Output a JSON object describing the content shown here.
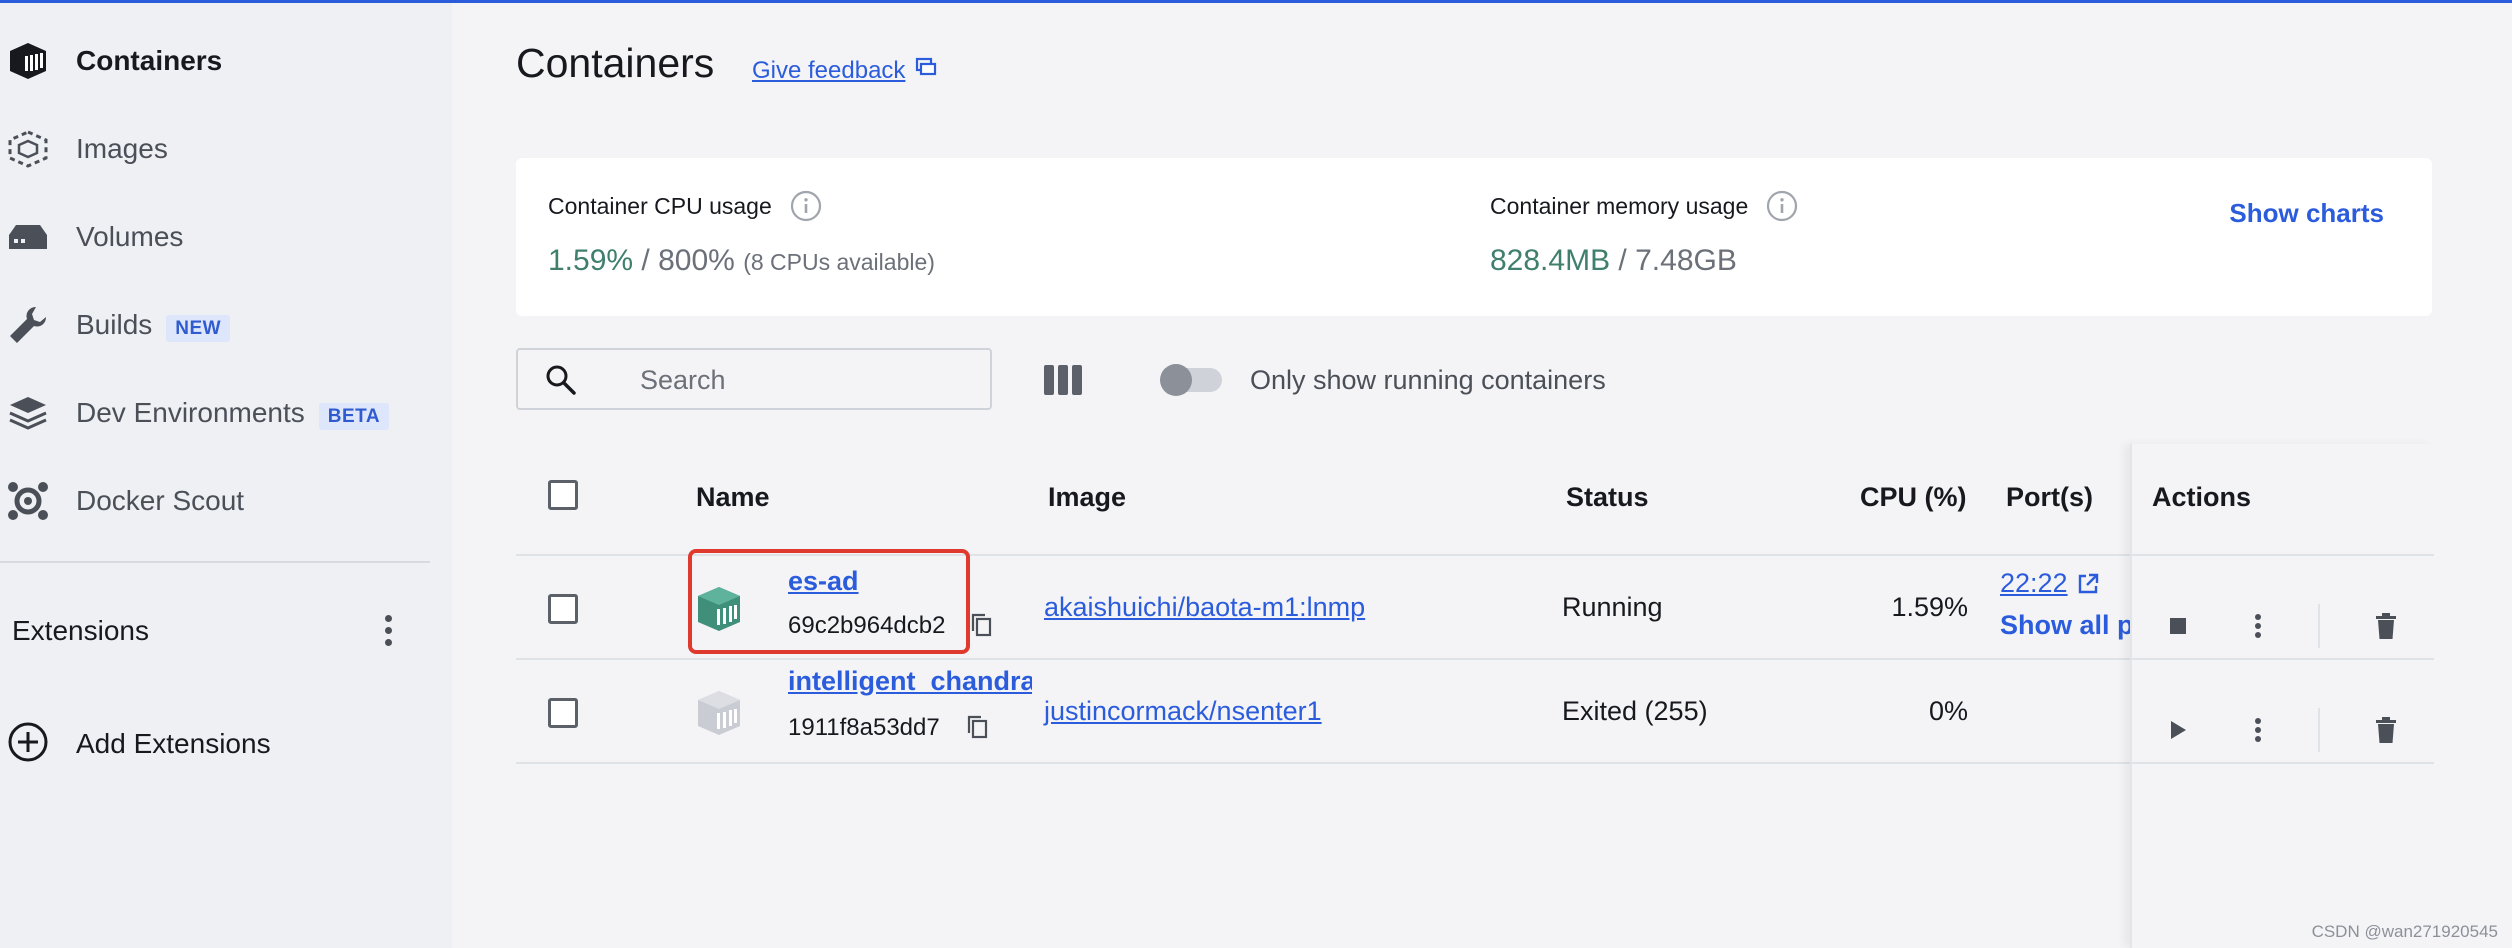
{
  "sidebar": {
    "items": [
      {
        "label": "Containers",
        "icon": "container-icon",
        "active": true
      },
      {
        "label": "Images",
        "icon": "images-icon"
      },
      {
        "label": "Volumes",
        "icon": "volumes-icon"
      },
      {
        "label": "Builds",
        "icon": "builds-icon",
        "badge": "NEW"
      },
      {
        "label": "Dev Environments",
        "icon": "dev-environments-icon",
        "badge": "BETA"
      },
      {
        "label": "Docker Scout",
        "icon": "docker-scout-icon"
      }
    ],
    "extensions_title": "Extensions",
    "add_extensions_label": "Add Extensions"
  },
  "header": {
    "title": "Containers",
    "feedback_label": "Give feedback"
  },
  "usage": {
    "cpu_label": "Container CPU usage",
    "cpu_used": "1.59%",
    "cpu_sep": "/",
    "cpu_total": "800%",
    "cpu_note": "(8 CPUs available)",
    "memory_label": "Container memory usage",
    "memory_used": "828.4MB",
    "memory_sep": "/",
    "memory_total": "7.48GB",
    "show_charts_label": "Show charts"
  },
  "toolbar": {
    "search_placeholder": "Search",
    "toggle_label": "Only show running containers",
    "toggle_on": false
  },
  "table": {
    "columns": [
      "Name",
      "Image",
      "Status",
      "CPU (%)",
      "Port(s)",
      "Actions"
    ],
    "rows": [
      {
        "name": "es-ad",
        "id": "69c2b964dcb2",
        "image": "akaishuichi/baota-m1:lnmp",
        "status": "Running",
        "cpu": "1.59%",
        "port": "22:22",
        "show_all_ports": "Show all ports",
        "running": true
      },
      {
        "name": "intelligent_chandrasekhar",
        "id": "1911f8a53dd7",
        "image": "justincormack/nsenter1",
        "status": "Exited (255)",
        "cpu": "0%",
        "port": "",
        "running": false
      }
    ]
  },
  "colors": {
    "accent": "#2b5cdc",
    "running_icon": "#3f8f7a",
    "highlight": "#e03a2f"
  },
  "watermark": "CSDN @wan271920545"
}
